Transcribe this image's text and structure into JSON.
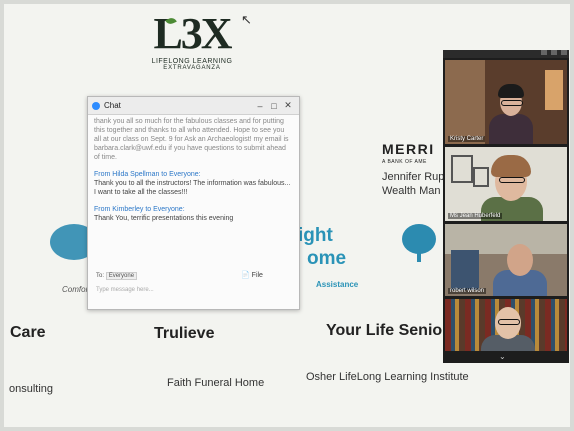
{
  "logo": {
    "mark": "L3X",
    "line1": "LIFELONG LEARNING",
    "line2": "EXTRAVAGANZA"
  },
  "sponsors": {
    "merrill": "MERRI",
    "merrill_sub": "A BANK OF AME",
    "jennifer": "Jennifer Rup",
    "wealth": "Wealth Man",
    "bright_line1": "ight",
    "bright_line2": "ome",
    "bright_line3": "Assistance",
    "left_logo_text": "Comforte",
    "care": "Care",
    "trulieve": "Trulieve",
    "yourlife": "Your Life Senio",
    "consulting": "onsulting",
    "faith": "Faith Funeral Home",
    "osher": "Osher LifeLong Learning Institute"
  },
  "chat": {
    "title": "Chat",
    "messages": [
      {
        "from": "",
        "text": "thank you all so much for the fabulous classes and for putting this together and thanks to all who attended. Hope to see you all at our class on Sept. 9 for Ask an Archaeologist! my email is barbara.clark@uwf.edu if you have questions to submit ahead of time."
      },
      {
        "from": "From Hilda Spellman to Everyone:",
        "text": "Thank you to all the instructors! The information was fabulous... I want to take all the classes!!!"
      },
      {
        "from": "From Kimberley to Everyone:",
        "text": "Thank You, terrific presentations this evening"
      }
    ],
    "to_label": "To:",
    "to_value": "Everyone",
    "file_label": "File",
    "input_placeholder": "Type message here..."
  },
  "video": {
    "participants": [
      {
        "name": "Kristy Carter"
      },
      {
        "name": "Ms Jean Huberfeld"
      },
      {
        "name": "robert wilson"
      },
      {
        "name": ""
      }
    ]
  }
}
